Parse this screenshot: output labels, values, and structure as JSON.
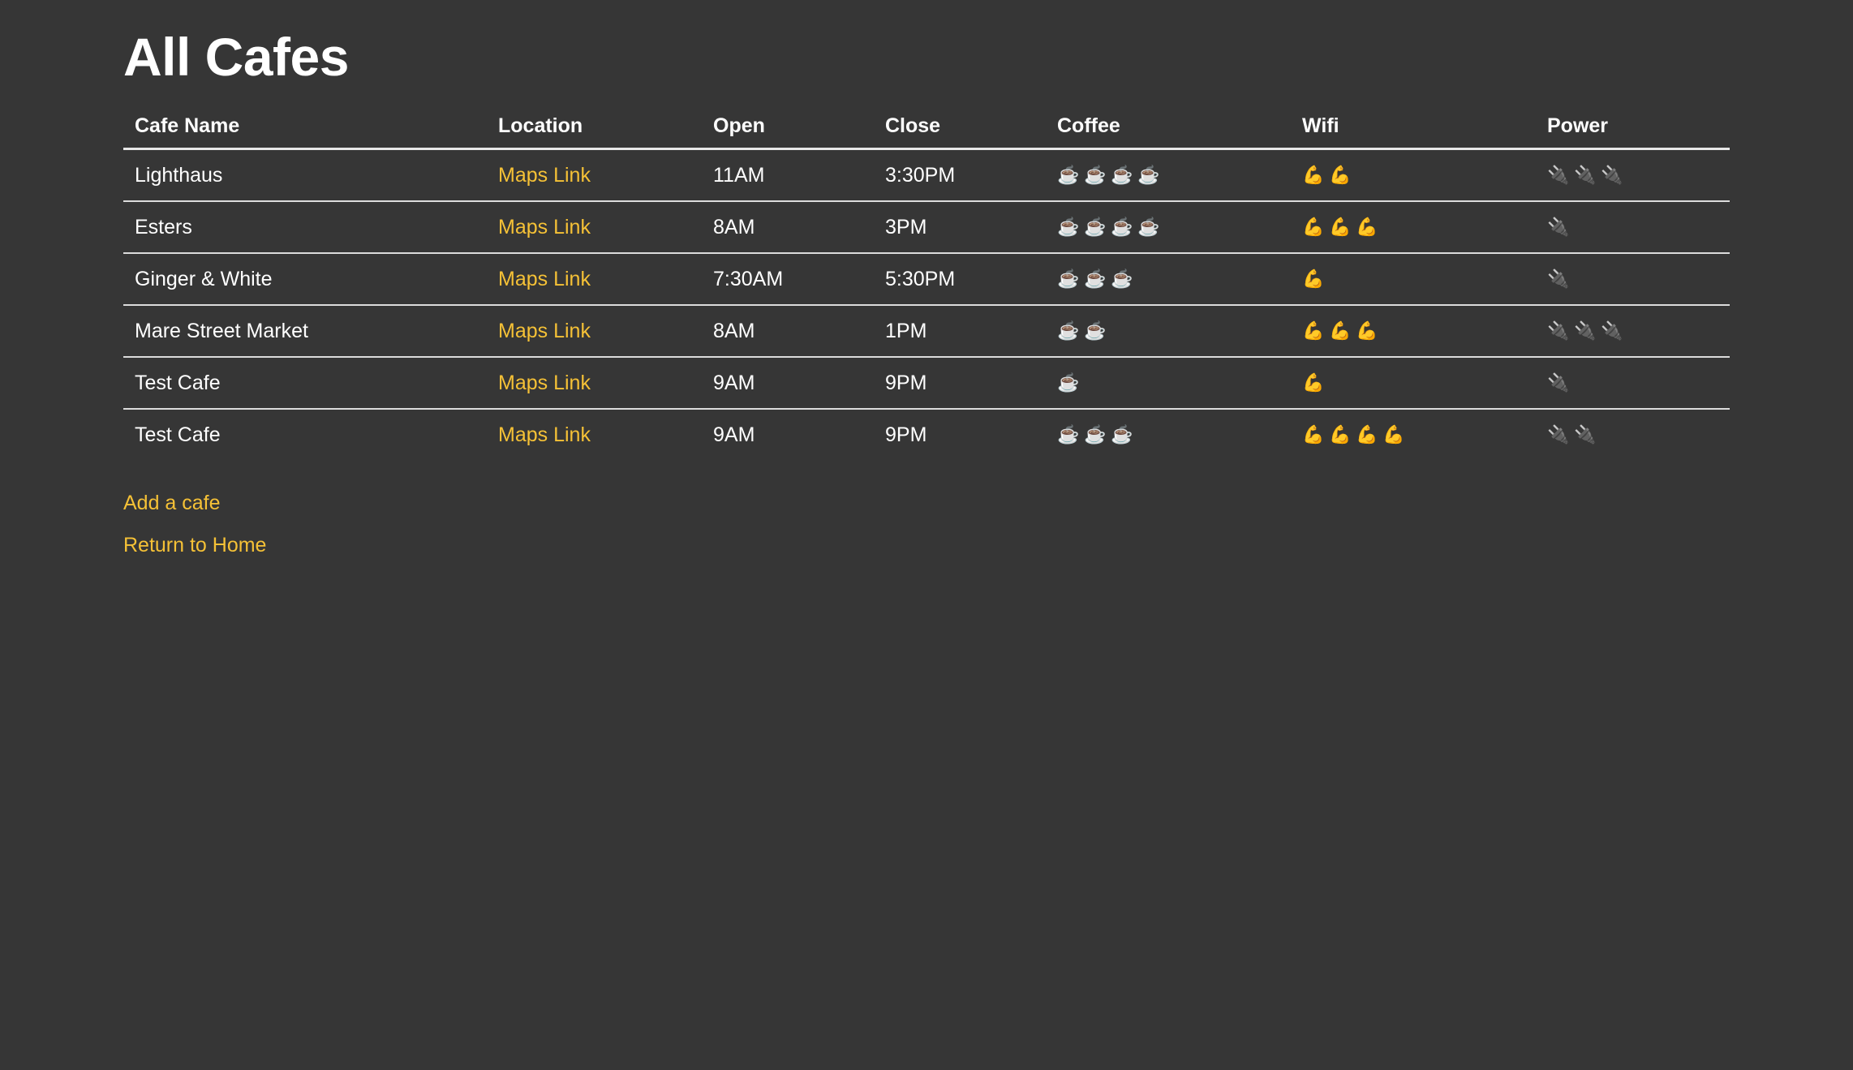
{
  "page": {
    "title": "All Cafes"
  },
  "table": {
    "headers": [
      "Cafe Name",
      "Location",
      "Open",
      "Close",
      "Coffee",
      "Wifi",
      "Power"
    ],
    "rows": [
      {
        "name": "Lighthaus",
        "location": "Maps Link",
        "open": "11AM",
        "close": "3:30PM",
        "coffee": 4,
        "wifi": 2,
        "power": 3
      },
      {
        "name": "Esters",
        "location": "Maps Link",
        "open": "8AM",
        "close": "3PM",
        "coffee": 4,
        "wifi": 3,
        "power": 1
      },
      {
        "name": "Ginger & White",
        "location": "Maps Link",
        "open": "7:30AM",
        "close": "5:30PM",
        "coffee": 3,
        "wifi": 1,
        "power": 1
      },
      {
        "name": "Mare Street Market",
        "location": "Maps Link",
        "open": "8AM",
        "close": "1PM",
        "coffee": 2,
        "wifi": 3,
        "power": 3
      },
      {
        "name": "Test Cafe",
        "location": "Maps Link",
        "open": "9AM",
        "close": "9PM",
        "coffee": 1,
        "wifi": 1,
        "power": 1
      },
      {
        "name": "Test Cafe",
        "location": "Maps Link",
        "open": "9AM",
        "close": "9PM",
        "coffee": 3,
        "wifi": 4,
        "power": 2
      }
    ]
  },
  "icons": {
    "coffee": "coffee-cup-icon",
    "wifi": "flexed-biceps-icon",
    "power": "electric-plug-icon"
  },
  "links": {
    "add_cafe": "Add a cafe",
    "return_home": "Return to Home"
  },
  "colors": {
    "background": "#363636",
    "text": "#ffffff",
    "link": "#f5c136"
  }
}
